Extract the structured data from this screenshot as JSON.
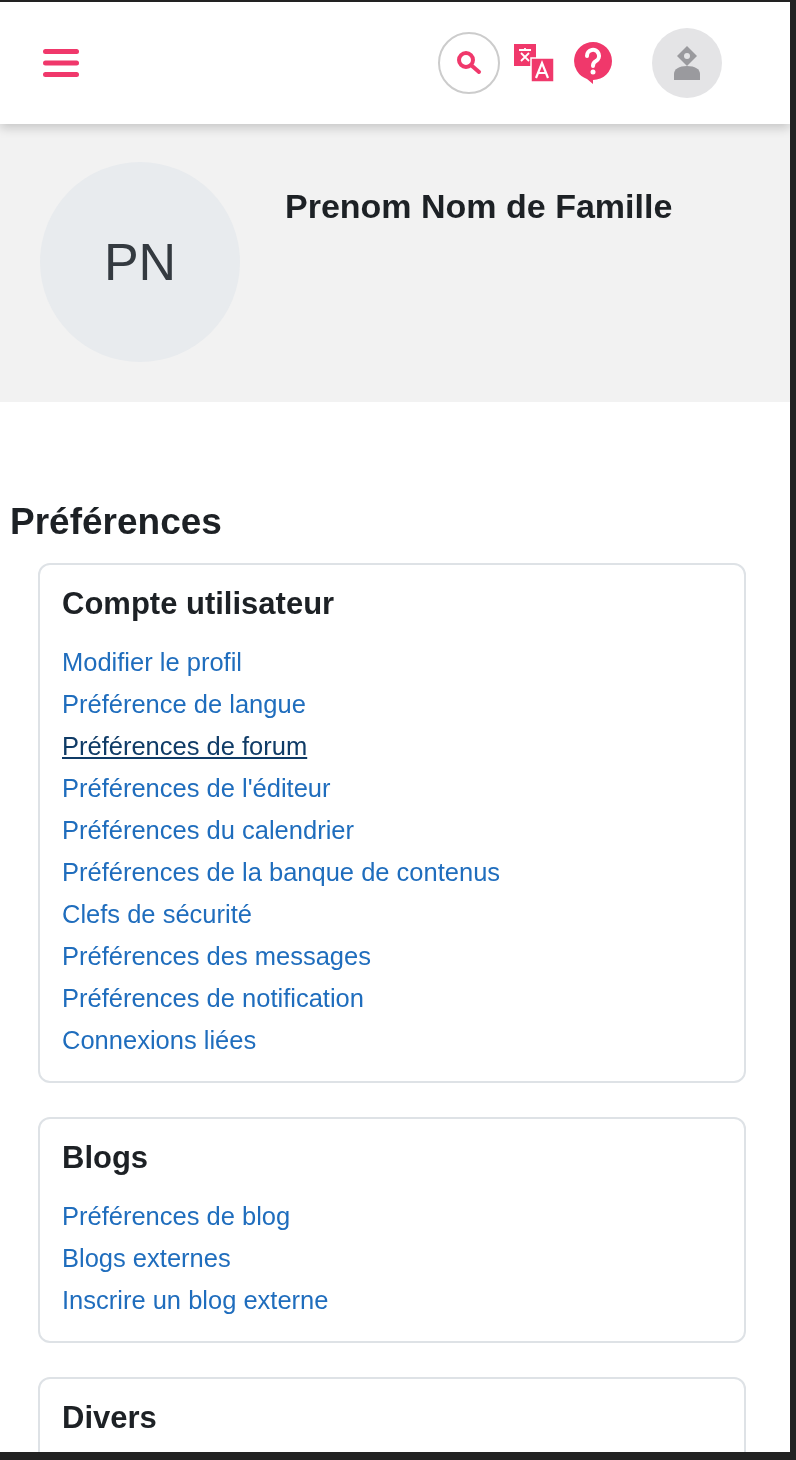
{
  "header": {
    "avatar_label": "PN",
    "name": "Prenom Nom de Famille"
  },
  "page_title": "Préférences",
  "sections": [
    {
      "title": "Compte utilisateur",
      "links": [
        {
          "label": "Modifier le profil",
          "hovered": false
        },
        {
          "label": "Préférence de langue",
          "hovered": false
        },
        {
          "label": "Préférences de forum",
          "hovered": true
        },
        {
          "label": "Préférences de l'éditeur",
          "hovered": false
        },
        {
          "label": "Préférences du calendrier",
          "hovered": false
        },
        {
          "label": "Préférences de la banque de contenus",
          "hovered": false
        },
        {
          "label": "Clefs de sécurité",
          "hovered": false
        },
        {
          "label": "Préférences des messages",
          "hovered": false
        },
        {
          "label": "Préférences de notification",
          "hovered": false
        },
        {
          "label": "Connexions liées",
          "hovered": false
        }
      ]
    },
    {
      "title": "Blogs",
      "links": [
        {
          "label": "Préférences de blog",
          "hovered": false
        },
        {
          "label": "Blogs externes",
          "hovered": false
        },
        {
          "label": "Inscrire un blog externe",
          "hovered": false
        }
      ]
    },
    {
      "title": "Divers"
    }
  ]
}
